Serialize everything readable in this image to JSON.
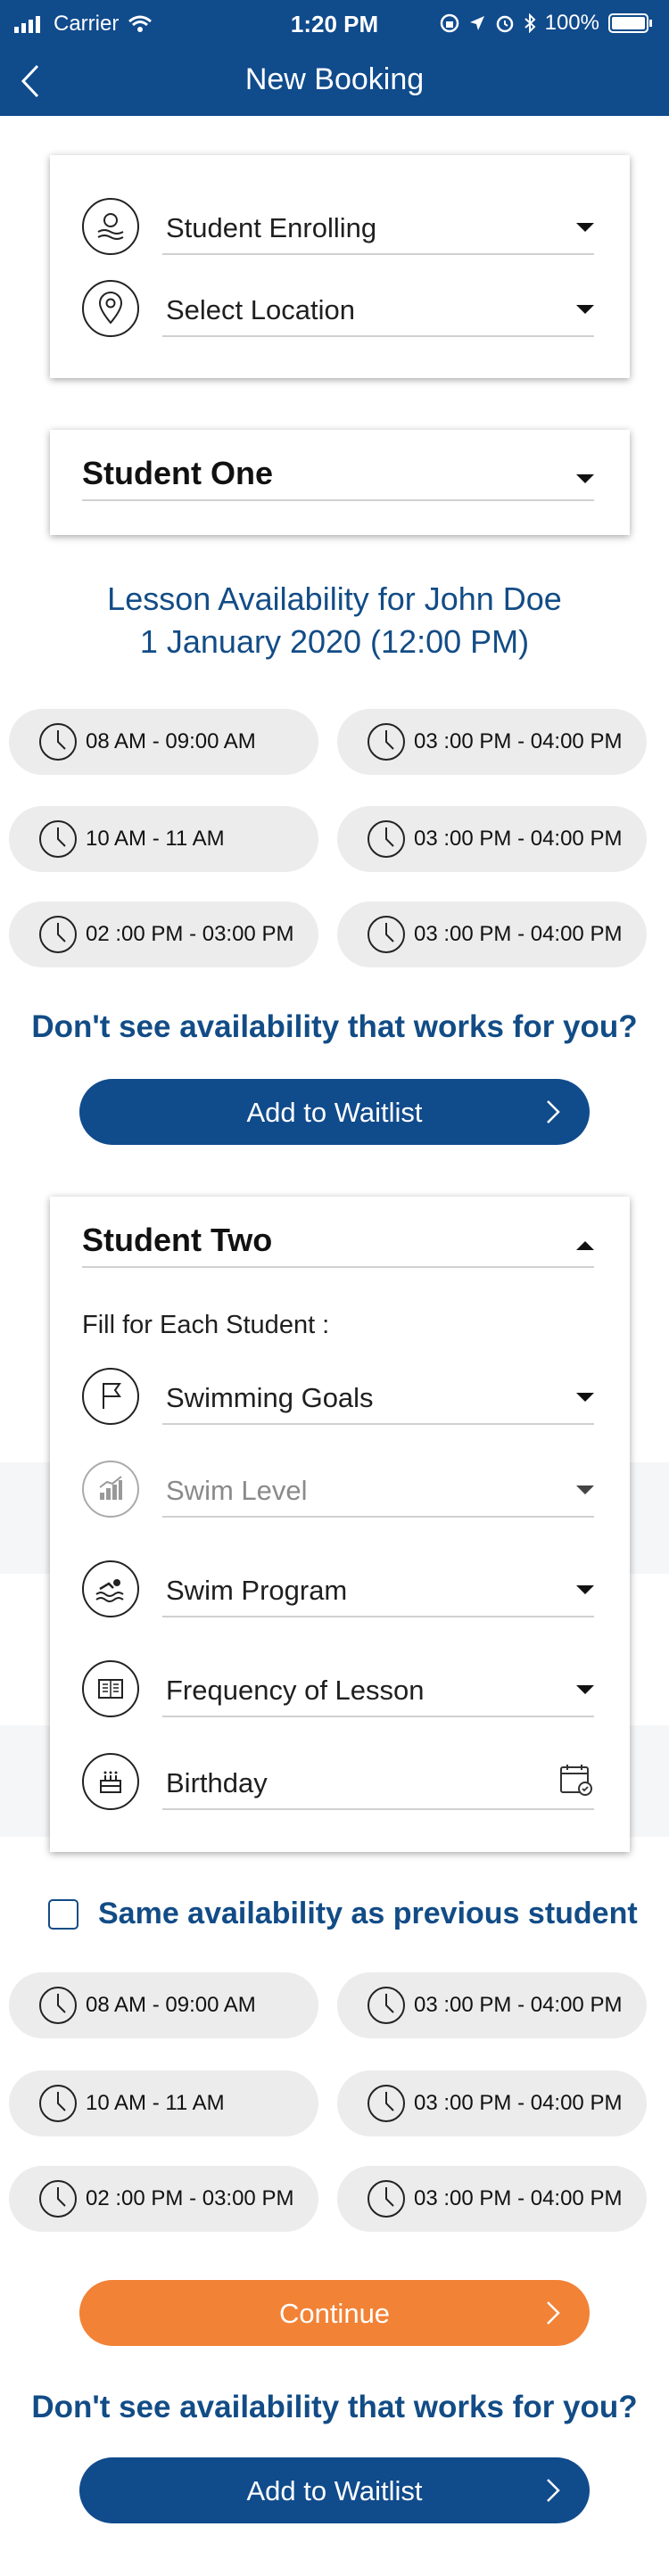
{
  "status_bar": {
    "carrier": "Carrier",
    "time": "1:20 PM",
    "battery": "100%"
  },
  "header": {
    "title": "New Booking",
    "back_icon": "chevron-left-icon"
  },
  "top_card": {
    "student_enrolling": "Student Enrolling",
    "select_location": "Select Location"
  },
  "student_one": {
    "label": "Student One"
  },
  "availability": {
    "title_line1": "Lesson Availability for John Doe",
    "title_line2": "1 January 2020 (12:00 PM)",
    "slots": [
      "08 AM - 09:00 AM",
      "03 :00 PM - 04:00 PM",
      "10 AM - 11 AM",
      "03 :00 PM - 04:00 PM",
      "02 :00 PM - 03:00 PM",
      "03 :00 PM - 04:00 PM"
    ]
  },
  "waitlist_prompt": "Don't see availability that works for you?",
  "add_waitlist_label": "Add to Waitlist",
  "student_two": {
    "label": "Student Two",
    "fill_label": "Fill for Each Student :",
    "fields": {
      "swimming_goals": "Swimming Goals",
      "swim_level": "Swim Level",
      "swim_program": "Swim Program",
      "frequency": "Frequency of Lesson",
      "birthday": "Birthday"
    }
  },
  "same_availability_label": "Same availability as previous student",
  "availability_two": {
    "slots": [
      "08 AM - 09:00 AM",
      "03 :00 PM - 04:00 PM",
      "10 AM - 11 AM",
      "03 :00 PM - 04:00 PM",
      "02 :00 PM - 03:00 PM",
      "03 :00 PM - 04:00 PM"
    ]
  },
  "continue_label": "Continue",
  "colors": {
    "primary": "#104b8c",
    "accent": "#f28236",
    "slot_bg": "#ececec",
    "text_blue": "#124c86"
  }
}
